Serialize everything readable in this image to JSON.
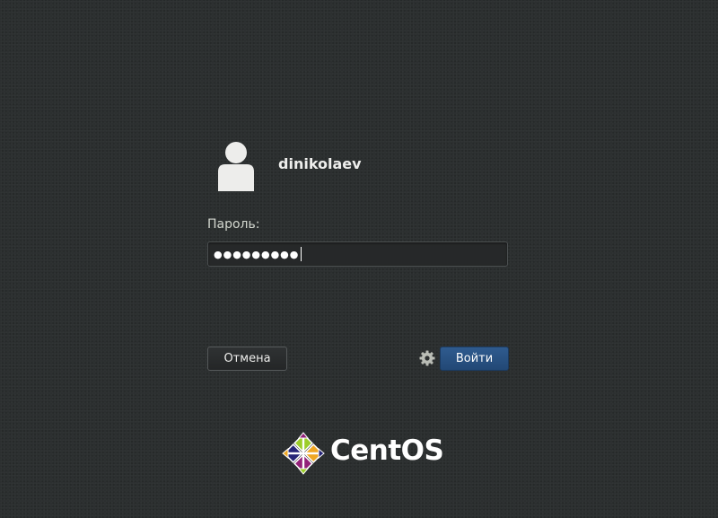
{
  "user": {
    "name": "dinikolaev",
    "avatar_icon": "user-avatar-icon"
  },
  "password": {
    "label": "Пароль:",
    "masked_value": "●●●●●●●●●"
  },
  "buttons": {
    "cancel_label": "Отмена",
    "login_label": "Войти",
    "settings_icon": "gear-icon"
  },
  "brand": {
    "name": "CentOS",
    "logo_icon": "centos-logo-icon"
  },
  "colors": {
    "background": "#2c2f30",
    "accent": "#2a5384",
    "text": "#eeeeec"
  }
}
